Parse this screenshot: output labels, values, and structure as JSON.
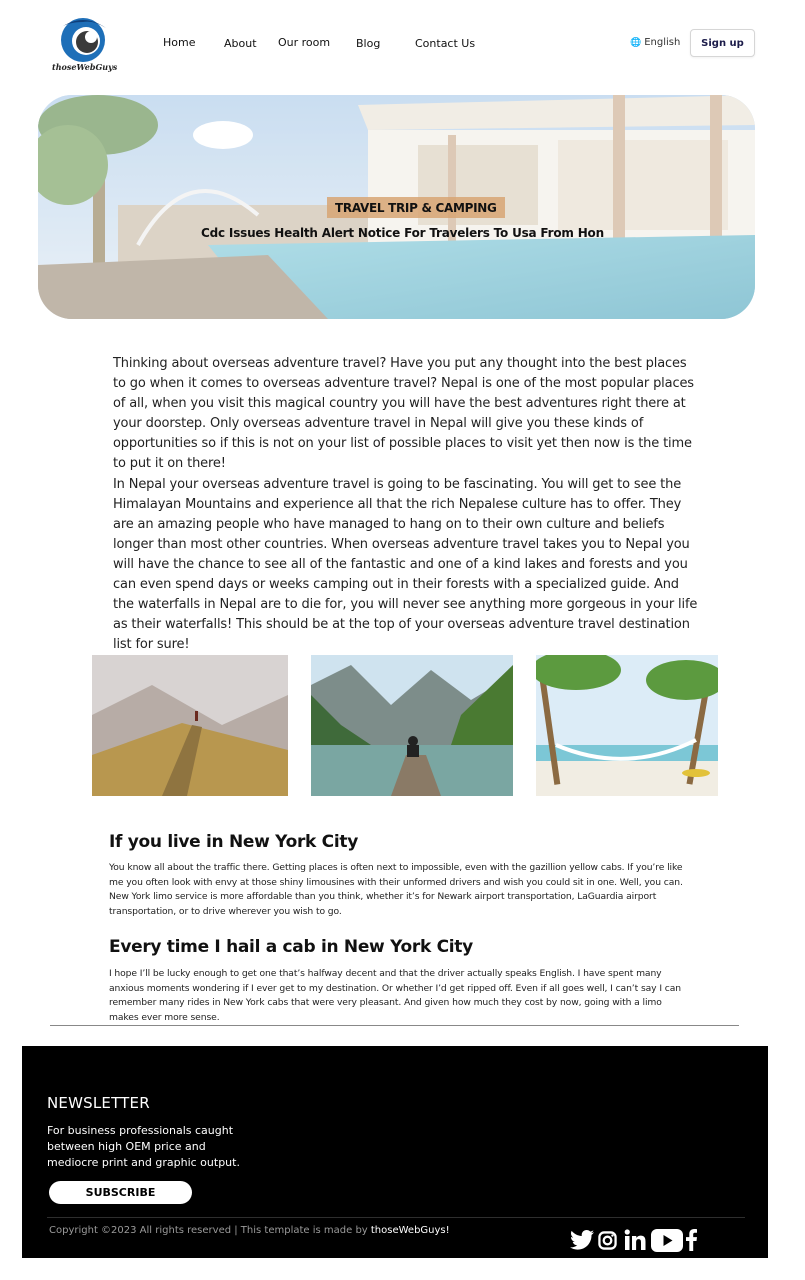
{
  "header": {
    "logo_text": "thoseWebGuys",
    "nav": [
      "Home",
      "About",
      "Our room",
      "Blog",
      "Contact Us"
    ],
    "language": "English",
    "signup_label": "Sign up"
  },
  "hero": {
    "tag": "TRAVEL TRIP & CAMPING",
    "title": "Cdc Issues Health Alert Notice For Travelers To Usa From Hon"
  },
  "article": {
    "paragraphs": [
      "Thinking about overseas adventure travel? Have you put any thought into the best places to go when it comes to overseas adventure travel? Nepal is one of the most popular places of all, when you visit this magical country you will have the best adventures right there at your doorstep. Only overseas adventure travel in Nepal will give you these kinds of opportunities so if this is not on your list of possible places to visit yet then now is the time to put it on there!",
      "In Nepal your overseas adventure travel is going to be fascinating. You will get to see the Himalayan Mountains and experience all that the rich Nepalese culture has to offer. They are an amazing people who have managed to hang on to their own culture and beliefs longer than most other countries. When overseas adventure travel takes you to Nepal you will have the chance to see all of the fantastic and one of a kind lakes and forests and you can even spend days or weeks camping out in their forests with a specialized guide. And the waterfalls in Nepal are to die for, you will never see anything more gorgeous in your life as their waterfalls! This should be at the top of your overseas adventure travel destination list for sure!"
    ],
    "sections": [
      {
        "heading": "If you live in New York City",
        "body": "You know all about the traffic there. Getting places is often next to impossible, even with the gazillion yellow cabs. If you’re like me you often look with envy at those shiny limousines with their unformed drivers and wish you could sit in one. Well, you can. New York limo service is more affordable than you think, whether it’s for Newark airport transportation, LaGuardia airport transportation, or to drive wherever you wish to go."
      },
      {
        "heading": "Every time I hail a cab in New York City",
        "body": "I hope I’ll be lucky enough to get one that’s halfway decent and that the driver actually speaks English. I have spent many anxious moments wondering if I ever get to my destination. Or whether I’d get ripped off. Even if all goes well, I can’t say I can remember many rides in New York cabs that were very pleasant. And given how much they cost by now, going with a limo makes ever more sense."
      }
    ]
  },
  "footer": {
    "newsletter_title": "NEWSLETTER",
    "newsletter_desc": "For business professionals caught between high OEM price and mediocre print and graphic output.",
    "subscribe_label": "SUBSCRIBE",
    "copyright_prefix": "Copyright ©2023 All rights reserved | This template is made by ",
    "copyright_brand": "thoseWebGuys!",
    "social": [
      "twitter-icon",
      "instagram-icon",
      "linkedin-icon",
      "youtube-icon",
      "facebook-icon"
    ]
  },
  "colors": {
    "footer_bg": "#000000",
    "hero_tag_bg": "#d7a573",
    "logo_blue": "#1e6fb8"
  }
}
